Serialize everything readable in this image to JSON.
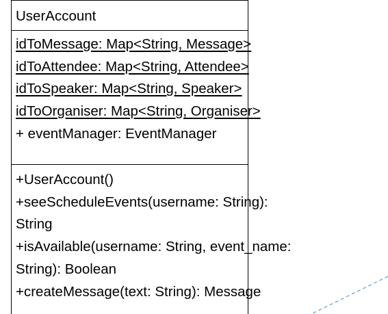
{
  "class_name": "UserAccount",
  "attributes": [
    {
      "text": "idToMessage: Map<String, Message>",
      "static": true
    },
    {
      "text": "idToAttendee: Map<String, Attendee>",
      "static": true
    },
    {
      "text": "idToSpeaker: Map<String, Speaker>",
      "static": true
    },
    {
      "text": "idToOrganiser: Map<String, Organiser>",
      "static": true
    },
    {
      "text": "+ eventManager: EventManager",
      "static": false
    }
  ],
  "operations": [
    "+UserAccount()",
    "+seeScheduleEvents(username: String):",
    "String",
    "+isAvailable(username: String, event_name:",
    "String): Boolean",
    "+createMessage(text: String): Message"
  ],
  "colors": {
    "border": "#000000",
    "text": "#000000",
    "connector": "#5b9bd5"
  }
}
